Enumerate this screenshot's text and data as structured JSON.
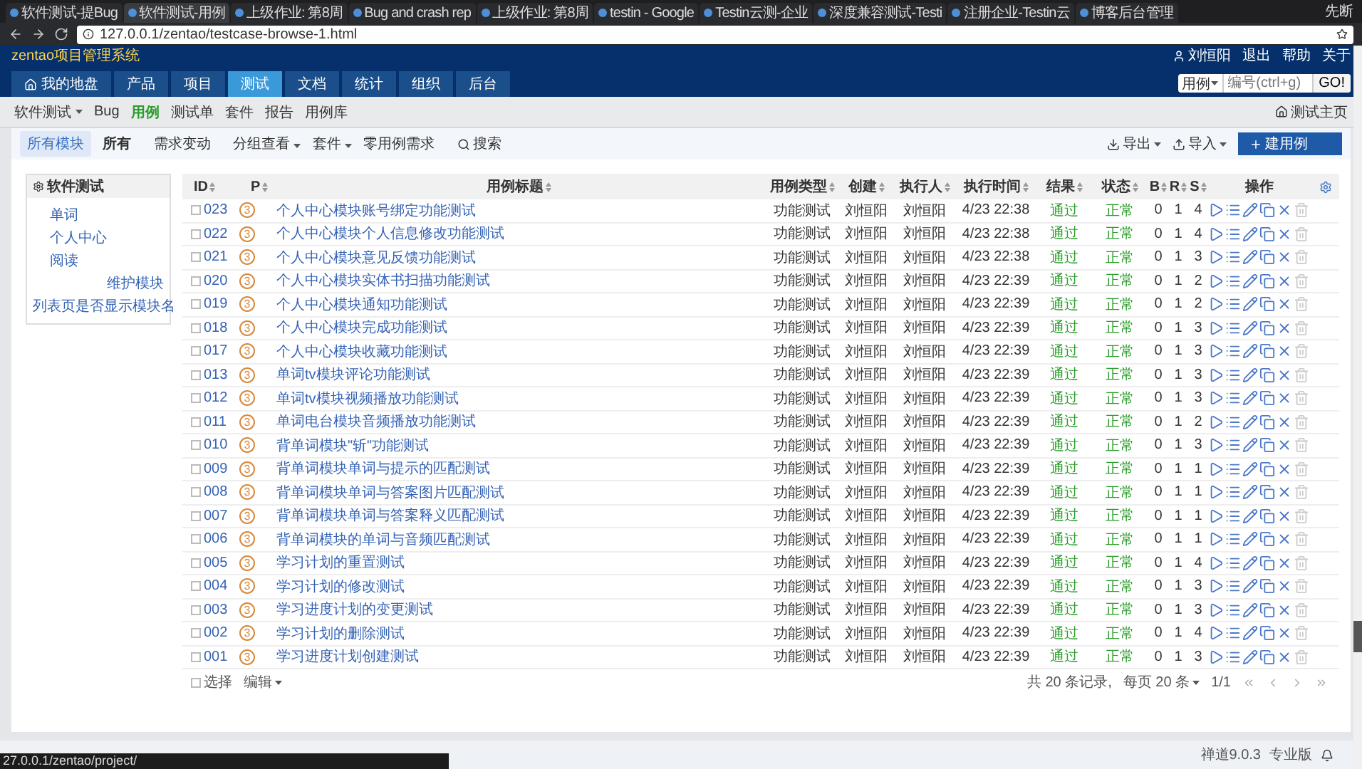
{
  "browser": {
    "tabs": [
      {
        "title": "软件测试-提Bug",
        "selected": false
      },
      {
        "title": "软件测试-用例",
        "selected": true
      },
      {
        "title": "上级作业: 第8周",
        "selected": false
      },
      {
        "title": "Bug and crash rep",
        "selected": false
      },
      {
        "title": "上级作业: 第8周",
        "selected": false
      },
      {
        "title": "testin - Google",
        "selected": false
      },
      {
        "title": "Testin云测-企业",
        "selected": false
      },
      {
        "title": "深度兼容测试-Testi",
        "selected": false
      },
      {
        "title": "注册企业-Testin云",
        "selected": false
      },
      {
        "title": "博客后台管理",
        "selected": false
      }
    ],
    "profile": "先断",
    "url": "127.0.0.1/zentao/testcase-browse-1.html"
  },
  "header": {
    "brand": "zentao项目管理系统",
    "user": "刘恒阳",
    "links": [
      "退出",
      "帮助",
      "关于"
    ],
    "nav": [
      {
        "label": "我的地盘",
        "selected": false
      },
      {
        "label": "产品",
        "selected": false
      },
      {
        "label": "项目",
        "selected": false
      },
      {
        "label": "测试",
        "selected": true
      },
      {
        "label": "文档",
        "selected": false
      },
      {
        "label": "统计",
        "selected": false
      },
      {
        "label": "组织",
        "selected": false
      },
      {
        "label": "后台",
        "selected": false
      }
    ],
    "search": {
      "select": "用例",
      "placeholder": "编号(ctrl+g)",
      "button": "GO!"
    }
  },
  "subnav": {
    "product": "软件测试",
    "items": [
      {
        "label": "Bug",
        "selected": false
      },
      {
        "label": "用例",
        "selected": true
      },
      {
        "label": "测试单",
        "selected": false
      },
      {
        "label": "套件",
        "selected": false
      },
      {
        "label": "报告",
        "selected": false
      },
      {
        "label": "用例库",
        "selected": false
      }
    ],
    "home": "测试主页"
  },
  "toolbar": {
    "module": "所有模块",
    "filters": [
      {
        "label": "所有",
        "dropdown": false,
        "selected": true
      },
      {
        "label": "需求变动",
        "dropdown": false,
        "selected": false
      },
      {
        "label": "分组查看",
        "dropdown": true,
        "selected": false
      },
      {
        "label": "套件",
        "dropdown": true,
        "selected": false
      },
      {
        "label": "零用例需求",
        "dropdown": false,
        "selected": false
      }
    ],
    "search": "搜索",
    "export": "导出",
    "import": "导入",
    "create": "建用例"
  },
  "sidebar": {
    "title": "软件测试",
    "items": [
      "单词",
      "个人中心",
      "阅读"
    ],
    "links": [
      "维护模块",
      "列表页是否显示模块名"
    ]
  },
  "table": {
    "columns": [
      "ID",
      "P",
      "用例标题",
      "用例类型",
      "创建",
      "执行人",
      "执行时间",
      "结果",
      "状态",
      "B",
      "R",
      "S",
      "操作"
    ],
    "rows": [
      {
        "id": "023",
        "checked": false,
        "priority": "3",
        "title": "个人中心模块账号绑定功能测试",
        "type": "功能测试",
        "creator": "刘恒阳",
        "executor": "刘恒阳",
        "time": "4/23 22:38",
        "result": "通过",
        "status": "正常",
        "b": "0",
        "r": "1",
        "s": "4"
      },
      {
        "id": "022",
        "checked": false,
        "priority": "3",
        "title": "个人中心模块个人信息修改功能测试",
        "type": "功能测试",
        "creator": "刘恒阳",
        "executor": "刘恒阳",
        "time": "4/23 22:38",
        "result": "通过",
        "status": "正常",
        "b": "0",
        "r": "1",
        "s": "4"
      },
      {
        "id": "021",
        "checked": false,
        "priority": "3",
        "title": "个人中心模块意见反馈功能测试",
        "type": "功能测试",
        "creator": "刘恒阳",
        "executor": "刘恒阳",
        "time": "4/23 22:38",
        "result": "通过",
        "status": "正常",
        "b": "0",
        "r": "1",
        "s": "3"
      },
      {
        "id": "020",
        "checked": false,
        "priority": "3",
        "title": "个人中心模块实体书扫描功能测试",
        "type": "功能测试",
        "creator": "刘恒阳",
        "executor": "刘恒阳",
        "time": "4/23 22:39",
        "result": "通过",
        "status": "正常",
        "b": "0",
        "r": "1",
        "s": "2"
      },
      {
        "id": "019",
        "checked": false,
        "priority": "3",
        "title": "个人中心模块通知功能测试",
        "type": "功能测试",
        "creator": "刘恒阳",
        "executor": "刘恒阳",
        "time": "4/23 22:39",
        "result": "通过",
        "status": "正常",
        "b": "0",
        "r": "1",
        "s": "2"
      },
      {
        "id": "018",
        "checked": false,
        "priority": "3",
        "title": "个人中心模块完成功能测试",
        "type": "功能测试",
        "creator": "刘恒阳",
        "executor": "刘恒阳",
        "time": "4/23 22:39",
        "result": "通过",
        "status": "正常",
        "b": "0",
        "r": "1",
        "s": "3"
      },
      {
        "id": "017",
        "checked": false,
        "priority": "3",
        "title": "个人中心模块收藏功能测试",
        "type": "功能测试",
        "creator": "刘恒阳",
        "executor": "刘恒阳",
        "time": "4/23 22:39",
        "result": "通过",
        "status": "正常",
        "b": "0",
        "r": "1",
        "s": "3"
      },
      {
        "id": "013",
        "checked": false,
        "priority": "3",
        "title": "单词tv模块评论功能测试",
        "type": "功能测试",
        "creator": "刘恒阳",
        "executor": "刘恒阳",
        "time": "4/23 22:39",
        "result": "通过",
        "status": "正常",
        "b": "0",
        "r": "1",
        "s": "3"
      },
      {
        "id": "012",
        "checked": false,
        "priority": "3",
        "title": "单词tv模块视频播放功能测试",
        "type": "功能测试",
        "creator": "刘恒阳",
        "executor": "刘恒阳",
        "time": "4/23 22:39",
        "result": "通过",
        "status": "正常",
        "b": "0",
        "r": "1",
        "s": "3"
      },
      {
        "id": "011",
        "checked": false,
        "priority": "3",
        "title": "单词电台模块音频播放功能测试",
        "type": "功能测试",
        "creator": "刘恒阳",
        "executor": "刘恒阳",
        "time": "4/23 22:39",
        "result": "通过",
        "status": "正常",
        "b": "0",
        "r": "1",
        "s": "2"
      },
      {
        "id": "010",
        "checked": false,
        "priority": "3",
        "title": "背单词模块\"斩\"功能测试",
        "type": "功能测试",
        "creator": "刘恒阳",
        "executor": "刘恒阳",
        "time": "4/23 22:39",
        "result": "通过",
        "status": "正常",
        "b": "0",
        "r": "1",
        "s": "3"
      },
      {
        "id": "009",
        "checked": false,
        "priority": "3",
        "title": "背单词模块单词与提示的匹配测试",
        "type": "功能测试",
        "creator": "刘恒阳",
        "executor": "刘恒阳",
        "time": "4/23 22:39",
        "result": "通过",
        "status": "正常",
        "b": "0",
        "r": "1",
        "s": "1"
      },
      {
        "id": "008",
        "checked": false,
        "priority": "3",
        "title": "背单词模块单词与答案图片匹配测试",
        "type": "功能测试",
        "creator": "刘恒阳",
        "executor": "刘恒阳",
        "time": "4/23 22:39",
        "result": "通过",
        "status": "正常",
        "b": "0",
        "r": "1",
        "s": "1"
      },
      {
        "id": "007",
        "checked": false,
        "priority": "3",
        "title": "背单词模块单词与答案释义匹配测试",
        "type": "功能测试",
        "creator": "刘恒阳",
        "executor": "刘恒阳",
        "time": "4/23 22:39",
        "result": "通过",
        "status": "正常",
        "b": "0",
        "r": "1",
        "s": "1"
      },
      {
        "id": "006",
        "checked": false,
        "priority": "3",
        "title": "背单词模块的单词与音频匹配测试",
        "type": "功能测试",
        "creator": "刘恒阳",
        "executor": "刘恒阳",
        "time": "4/23 22:39",
        "result": "通过",
        "status": "正常",
        "b": "0",
        "r": "1",
        "s": "1"
      },
      {
        "id": "005",
        "checked": false,
        "priority": "3",
        "title": "学习计划的重置测试",
        "type": "功能测试",
        "creator": "刘恒阳",
        "executor": "刘恒阳",
        "time": "4/23 22:39",
        "result": "通过",
        "status": "正常",
        "b": "0",
        "r": "1",
        "s": "4"
      },
      {
        "id": "004",
        "checked": false,
        "priority": "3",
        "title": "学习计划的修改测试",
        "type": "功能测试",
        "creator": "刘恒阳",
        "executor": "刘恒阳",
        "time": "4/23 22:39",
        "result": "通过",
        "status": "正常",
        "b": "0",
        "r": "1",
        "s": "3"
      },
      {
        "id": "003",
        "checked": false,
        "priority": "3",
        "title": "学习进度计划的变更测试",
        "type": "功能测试",
        "creator": "刘恒阳",
        "executor": "刘恒阳",
        "time": "4/23 22:39",
        "result": "通过",
        "status": "正常",
        "b": "0",
        "r": "1",
        "s": "3"
      },
      {
        "id": "002",
        "checked": false,
        "priority": "3",
        "title": "学习计划的删除测试",
        "type": "功能测试",
        "creator": "刘恒阳",
        "executor": "刘恒阳",
        "time": "4/23 22:39",
        "result": "通过",
        "status": "正常",
        "b": "0",
        "r": "1",
        "s": "4"
      },
      {
        "id": "001",
        "checked": false,
        "priority": "3",
        "title": "学习进度计划创建测试",
        "type": "功能测试",
        "creator": "刘恒阳",
        "executor": "刘恒阳",
        "time": "4/23 22:39",
        "result": "通过",
        "status": "正常",
        "b": "0",
        "r": "1",
        "s": "3"
      }
    ]
  },
  "table_footer": {
    "select_all": "选择",
    "checked": false,
    "edit": "编辑",
    "summary": "共 20 条记录,",
    "per_page": "每页 20 条",
    "pages": "1/1"
  },
  "status_bar": {
    "version": "禅道9.0.3",
    "edition": "专业版",
    "link_preview": "27.0.0.1/zentao/project/"
  }
}
